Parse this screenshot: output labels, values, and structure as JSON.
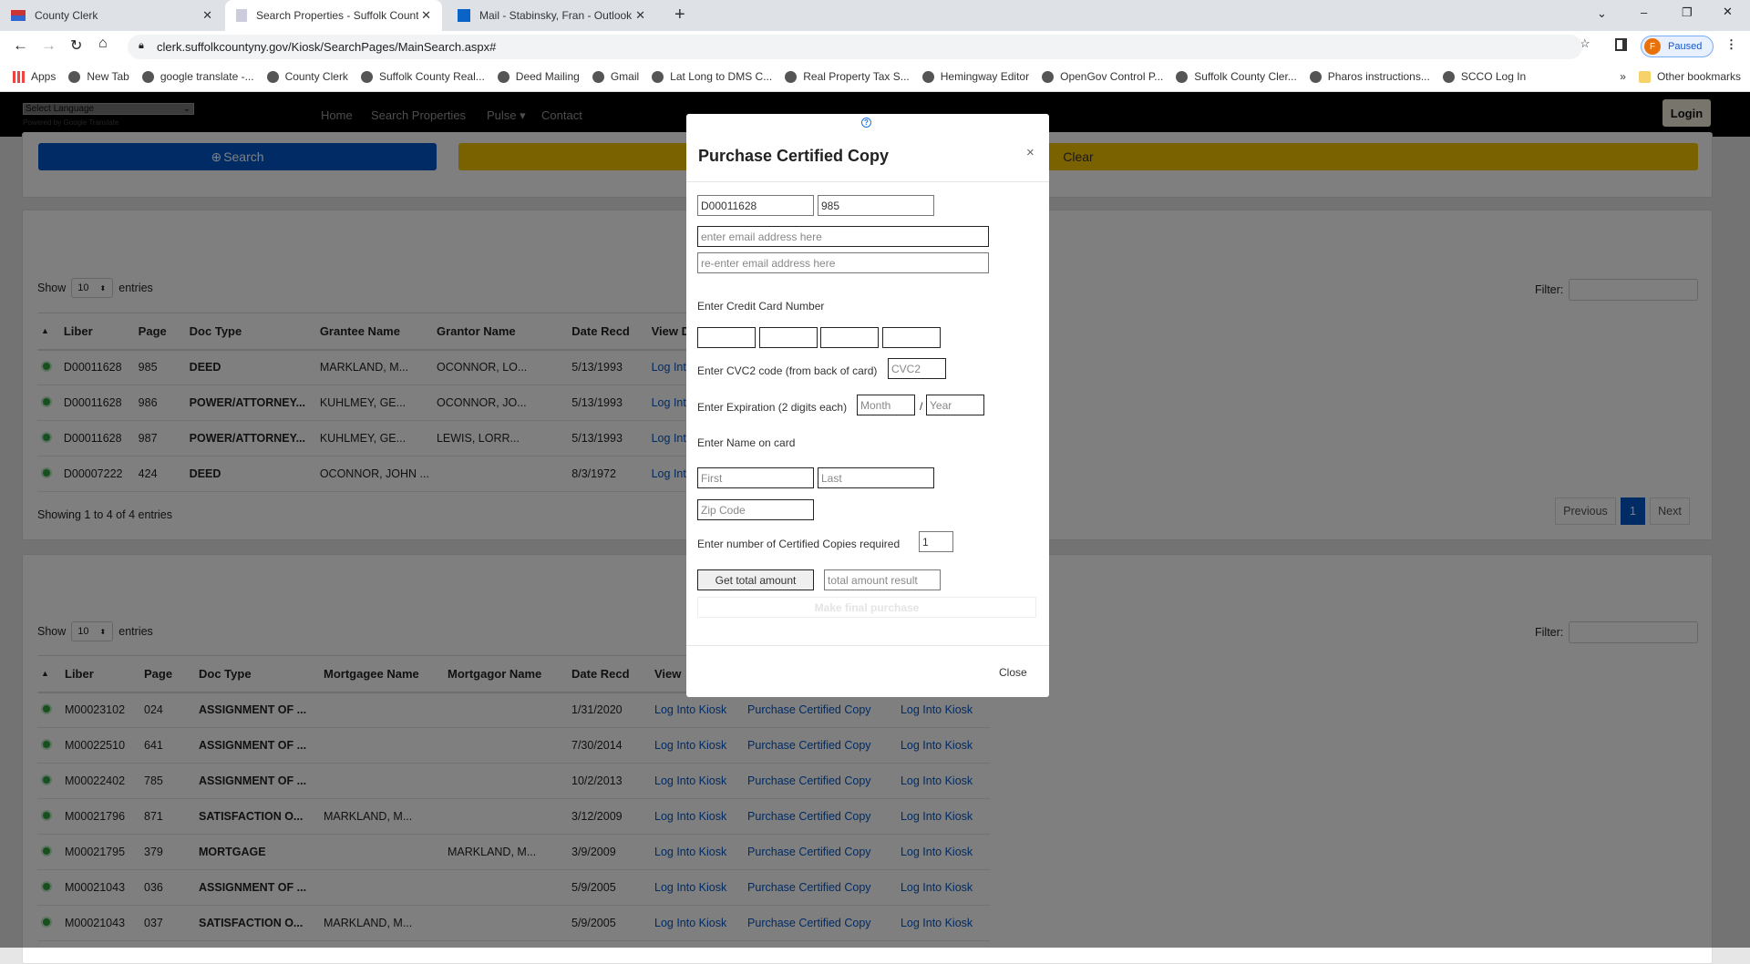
{
  "browser": {
    "tabs": [
      {
        "label": "County Clerk"
      },
      {
        "label": "Search Properties - Suffolk Count"
      },
      {
        "label": "Mail - Stabinsky, Fran - Outlook"
      }
    ],
    "url": "clerk.suffolkcountyny.gov/Kiosk/SearchPages/MainSearch.aspx#",
    "profile": {
      "initial": "F",
      "status": "Paused"
    },
    "bookmarks": [
      "Apps",
      "New Tab",
      "google translate -...",
      "County Clerk",
      "Suffolk County Real...",
      "Deed Mailing",
      "Gmail",
      "Lat Long to DMS C...",
      "Real Property Tax S...",
      "Hemingway Editor",
      "OpenGov Control P...",
      "Suffolk County Cler...",
      "Pharos instructions...",
      "SCCO Log In"
    ],
    "other_bookmarks": "Other bookmarks"
  },
  "header": {
    "language_select": "Select Language",
    "powered_by": "Powered by Google Translate",
    "nav": [
      "Home",
      "Search Properties",
      "Pulse",
      "Contact"
    ],
    "login": "Login"
  },
  "search": {
    "search_label": "Search",
    "clear_label": "Clear"
  },
  "deeds": {
    "show": "Show",
    "entries_value": "10",
    "entries": "entries",
    "filter": "Filter:",
    "columns": [
      "Liber",
      "Page",
      "Doc Type",
      "Grantee Name",
      "Grantor Name",
      "Date Recd",
      "View D"
    ],
    "rows": [
      [
        "D00011628",
        "985",
        "DEED",
        "MARKLAND, M...",
        "OCONNOR, LO...",
        "5/13/1993",
        "Log Int"
      ],
      [
        "D00011628",
        "986",
        "POWER/ATTORNEY...",
        "KUHLMEY, GE...",
        "OCONNOR, JO...",
        "5/13/1993",
        "Log Int"
      ],
      [
        "D00011628",
        "987",
        "POWER/ATTORNEY...",
        "KUHLMEY, GE...",
        "LEWIS, LORR...",
        "5/13/1993",
        "Log Int"
      ],
      [
        "D00007222",
        "424",
        "DEED",
        "OCONNOR, JOHN ...",
        "",
        "8/3/1972",
        "Log Int"
      ]
    ],
    "info": "Showing 1 to 4 of 4 entries",
    "pagination": {
      "previous": "Previous",
      "current": "1",
      "next": "Next"
    }
  },
  "mortgages": {
    "show": "Show",
    "entries_value": "10",
    "entries": "entries",
    "filter": "Filter:",
    "columns": [
      "Liber",
      "Page",
      "Doc Type",
      "Mortgagee Name",
      "Mortgagor Name",
      "Date Recd",
      "View"
    ],
    "rows": [
      [
        "M00023102",
        "024",
        "ASSIGNMENT OF ...",
        "",
        "",
        "1/31/2020",
        "Log Into Kiosk",
        "Purchase Certified Copy",
        "Log Into Kiosk"
      ],
      [
        "M00022510",
        "641",
        "ASSIGNMENT OF ...",
        "",
        "",
        "7/30/2014",
        "Log Into Kiosk",
        "Purchase Certified Copy",
        "Log Into Kiosk"
      ],
      [
        "M00022402",
        "785",
        "ASSIGNMENT OF ...",
        "",
        "",
        "10/2/2013",
        "Log Into Kiosk",
        "Purchase Certified Copy",
        "Log Into Kiosk"
      ],
      [
        "M00021796",
        "871",
        "SATISFACTION O...",
        "MARKLAND, M...",
        "",
        "3/12/2009",
        "Log Into Kiosk",
        "Purchase Certified Copy",
        "Log Into Kiosk"
      ],
      [
        "M00021795",
        "379",
        "MORTGAGE",
        "",
        "MARKLAND, M...",
        "3/9/2009",
        "Log Into Kiosk",
        "Purchase Certified Copy",
        "Log Into Kiosk"
      ],
      [
        "M00021043",
        "036",
        "ASSIGNMENT OF ...",
        "",
        "",
        "5/9/2005",
        "Log Into Kiosk",
        "Purchase Certified Copy",
        "Log Into Kiosk"
      ],
      [
        "M00021043",
        "037",
        "SATISFACTION O...",
        "MARKLAND, M...",
        "",
        "5/9/2005",
        "Log Into Kiosk",
        "Purchase Certified Copy",
        "Log Into Kiosk"
      ]
    ]
  },
  "modal": {
    "title": "Purchase Certified Copy",
    "liber": "D00011628",
    "page": "985",
    "email_placeholder": "enter email address here",
    "reemail_placeholder": "re-enter email address here",
    "cc_label": "Enter Credit Card Number",
    "cvc_label": "Enter CVC2 code (from back of card)",
    "cvc_placeholder": "CVC2",
    "exp_label": "Enter Expiration (2 digits each)",
    "month_placeholder": "Month",
    "year_placeholder": "Year",
    "slash": "/",
    "name_label": "Enter Name on card",
    "first_placeholder": "First",
    "last_placeholder": "Last",
    "zip_placeholder": "Zip Code",
    "copies_label": "Enter number of Certified Copies required",
    "copies": "1",
    "get_total": "Get total amount",
    "total_placeholder": "total amount result",
    "final": "Make final purchase",
    "close": "Close"
  },
  "colors": {
    "primary": "#0056c8",
    "clear": "#f5c400",
    "link": "#0056c8",
    "page_active": "#0056c8"
  }
}
